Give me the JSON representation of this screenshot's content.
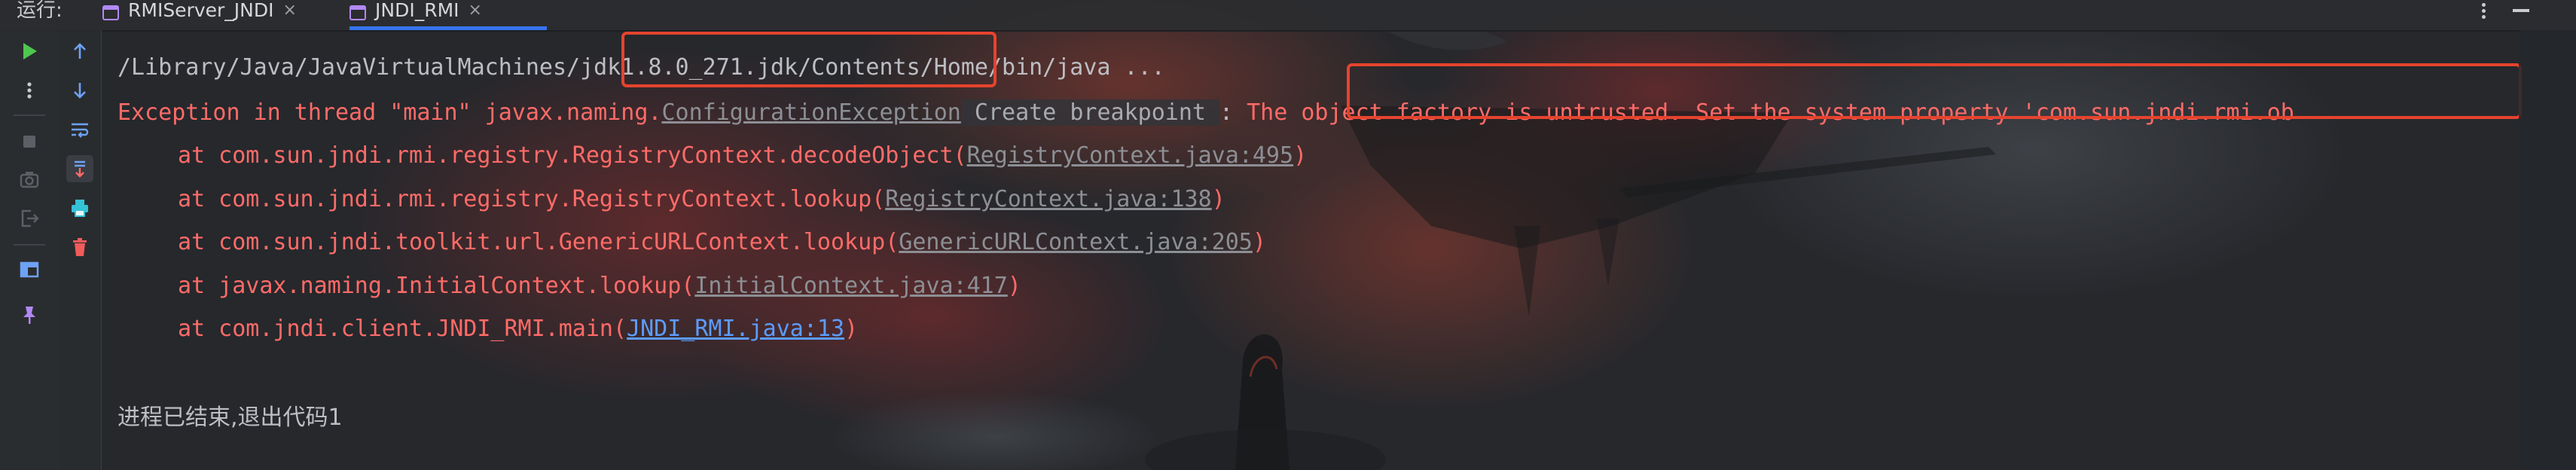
{
  "toolbar": {
    "run_label": "运行:",
    "tabs": [
      {
        "label": "RMIServer_JNDI",
        "close": "×"
      },
      {
        "label": "JNDI_RMI",
        "close": "×"
      }
    ]
  },
  "console": {
    "path": {
      "prefix": "/Library/Java/JavaVirtualMachines/",
      "jdk": "jdk1.8.0_271.jdk",
      "suffix": "/Contents/Home/bin/java ..."
    },
    "exception": {
      "prefix": "Exception in thread \"main\" javax.naming.",
      "class_link": "ConfigurationException",
      "breakpoint_hint": " Create breakpoint ",
      "colon": ": ",
      "message": "The object factory is untrusted. Set the system property 'com.sun.jndi.rmi.ob"
    },
    "stack": [
      {
        "at": "at com.sun.jndi.rmi.registry.RegistryContext.decodeObject(",
        "link": "RegistryContext.java:495",
        "end": ")"
      },
      {
        "at": "at com.sun.jndi.rmi.registry.RegistryContext.lookup(",
        "link": "RegistryContext.java:138",
        "end": ")"
      },
      {
        "at": "at com.sun.jndi.toolkit.url.GenericURLContext.lookup(",
        "link": "GenericURLContext.java:205",
        "end": ")"
      },
      {
        "at": "at javax.naming.InitialContext.lookup(",
        "link": "InitialContext.java:417",
        "end": ")"
      },
      {
        "at": "at com.jndi.client.JNDI_RMI.main(",
        "link": "JNDI_RMI.java:13",
        "end": ")"
      }
    ],
    "exit_message": "进程已结束,退出代码1"
  },
  "colors": {
    "error_text": "#ff6b68",
    "link_blue": "#5b9cff",
    "annotation_box": "#e5432e",
    "run_green": "#4ec74e",
    "action_blue": "#3574f0"
  },
  "icons": {
    "left_strip_a": [
      "run-icon",
      "more-options-icon",
      "stop-icon",
      "camera-icon",
      "exit-icon",
      "layout-icon",
      "pin-icon"
    ],
    "left_strip_b": [
      "up-arrow-icon",
      "down-arrow-icon",
      "soft-wrap-icon",
      "scroll-to-end-icon",
      "print-icon",
      "trash-icon"
    ]
  }
}
